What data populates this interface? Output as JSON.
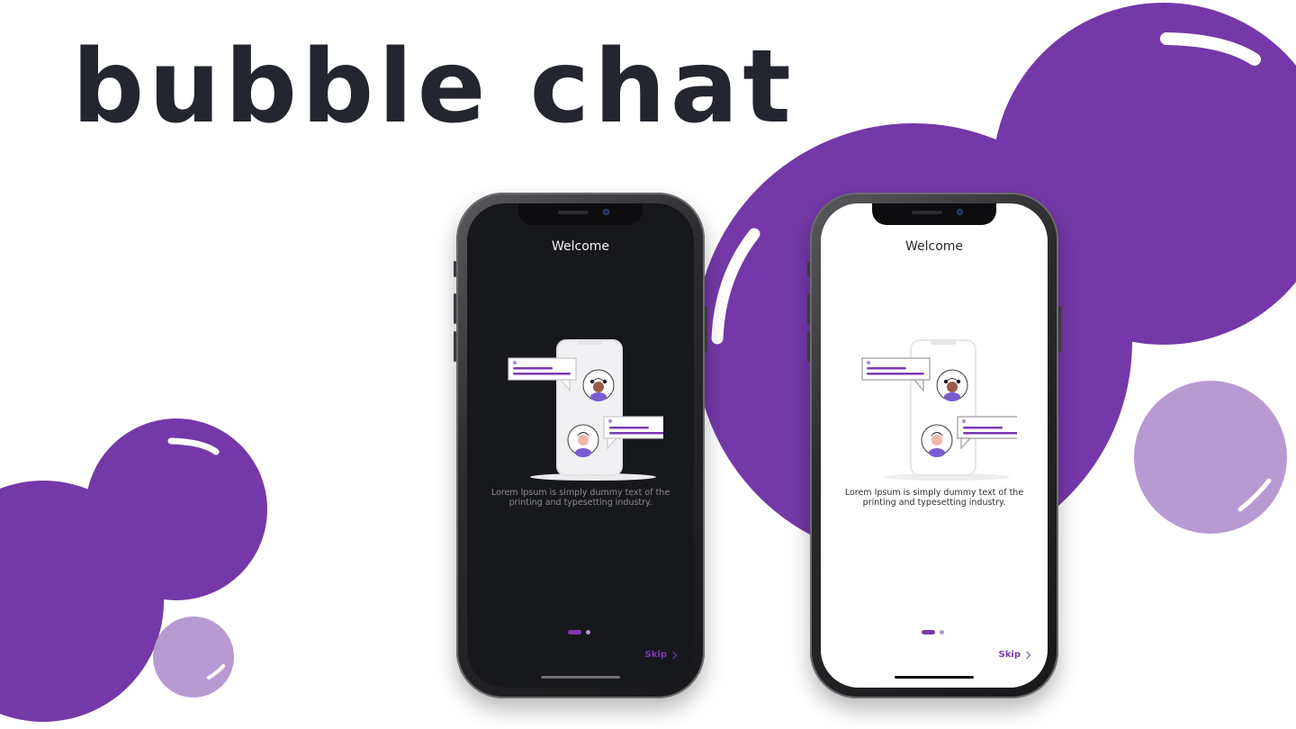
{
  "brand": {
    "title": "bubble chat"
  },
  "colors": {
    "bubble_purple": "#7538a8",
    "bubble_light": "#b89ad3",
    "accent": "#7b3ab0",
    "dark_screen": "#17181c",
    "light_screen": "#ffffff",
    "brand_text": "#23262e"
  },
  "phones": [
    {
      "theme": "dark",
      "welcome": "Welcome",
      "description_line1": "Lorem Ipsum is simply dummy text of the",
      "description_line2": "printing and typesetting industry.",
      "skip_label": "Skip",
      "skip_icon": "chevron-right-icon",
      "page_indicator": {
        "current": 1,
        "total": 2
      }
    },
    {
      "theme": "light",
      "welcome": "Welcome",
      "description_line1": "Lorem Ipsum is simply dummy text of the",
      "description_line2": "printing and typesetting industry.",
      "skip_label": "Skip",
      "skip_icon": "chevron-right-icon",
      "page_indicator": {
        "current": 1,
        "total": 2
      }
    }
  ]
}
